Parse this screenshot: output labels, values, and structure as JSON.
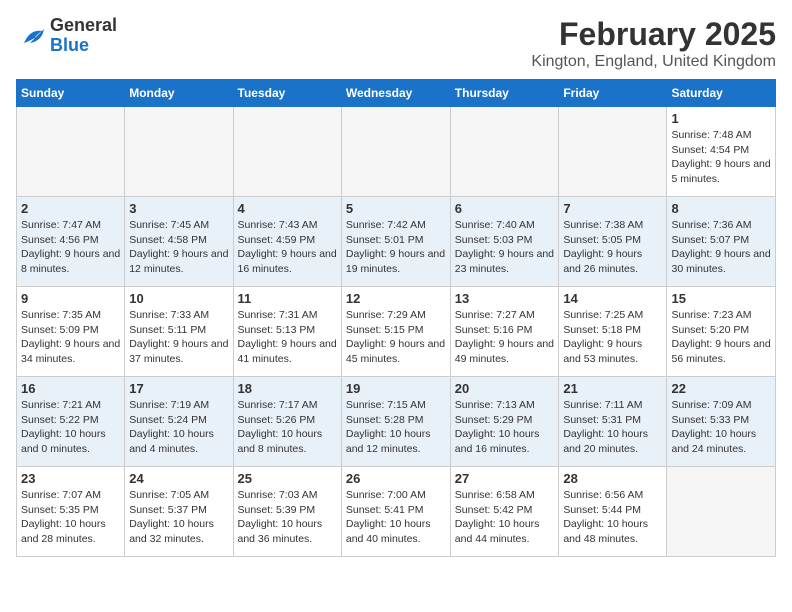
{
  "logo": {
    "text_general": "General",
    "text_blue": "Blue"
  },
  "title": "February 2025",
  "location": "Kington, England, United Kingdom",
  "weekdays": [
    "Sunday",
    "Monday",
    "Tuesday",
    "Wednesday",
    "Thursday",
    "Friday",
    "Saturday"
  ],
  "weeks": [
    [
      {
        "day": "",
        "info": ""
      },
      {
        "day": "",
        "info": ""
      },
      {
        "day": "",
        "info": ""
      },
      {
        "day": "",
        "info": ""
      },
      {
        "day": "",
        "info": ""
      },
      {
        "day": "",
        "info": ""
      },
      {
        "day": "1",
        "info": "Sunrise: 7:48 AM\nSunset: 4:54 PM\nDaylight: 9 hours and 5 minutes."
      }
    ],
    [
      {
        "day": "2",
        "info": "Sunrise: 7:47 AM\nSunset: 4:56 PM\nDaylight: 9 hours and 8 minutes."
      },
      {
        "day": "3",
        "info": "Sunrise: 7:45 AM\nSunset: 4:58 PM\nDaylight: 9 hours and 12 minutes."
      },
      {
        "day": "4",
        "info": "Sunrise: 7:43 AM\nSunset: 4:59 PM\nDaylight: 9 hours and 16 minutes."
      },
      {
        "day": "5",
        "info": "Sunrise: 7:42 AM\nSunset: 5:01 PM\nDaylight: 9 hours and 19 minutes."
      },
      {
        "day": "6",
        "info": "Sunrise: 7:40 AM\nSunset: 5:03 PM\nDaylight: 9 hours and 23 minutes."
      },
      {
        "day": "7",
        "info": "Sunrise: 7:38 AM\nSunset: 5:05 PM\nDaylight: 9 hours and 26 minutes."
      },
      {
        "day": "8",
        "info": "Sunrise: 7:36 AM\nSunset: 5:07 PM\nDaylight: 9 hours and 30 minutes."
      }
    ],
    [
      {
        "day": "9",
        "info": "Sunrise: 7:35 AM\nSunset: 5:09 PM\nDaylight: 9 hours and 34 minutes."
      },
      {
        "day": "10",
        "info": "Sunrise: 7:33 AM\nSunset: 5:11 PM\nDaylight: 9 hours and 37 minutes."
      },
      {
        "day": "11",
        "info": "Sunrise: 7:31 AM\nSunset: 5:13 PM\nDaylight: 9 hours and 41 minutes."
      },
      {
        "day": "12",
        "info": "Sunrise: 7:29 AM\nSunset: 5:15 PM\nDaylight: 9 hours and 45 minutes."
      },
      {
        "day": "13",
        "info": "Sunrise: 7:27 AM\nSunset: 5:16 PM\nDaylight: 9 hours and 49 minutes."
      },
      {
        "day": "14",
        "info": "Sunrise: 7:25 AM\nSunset: 5:18 PM\nDaylight: 9 hours and 53 minutes."
      },
      {
        "day": "15",
        "info": "Sunrise: 7:23 AM\nSunset: 5:20 PM\nDaylight: 9 hours and 56 minutes."
      }
    ],
    [
      {
        "day": "16",
        "info": "Sunrise: 7:21 AM\nSunset: 5:22 PM\nDaylight: 10 hours and 0 minutes."
      },
      {
        "day": "17",
        "info": "Sunrise: 7:19 AM\nSunset: 5:24 PM\nDaylight: 10 hours and 4 minutes."
      },
      {
        "day": "18",
        "info": "Sunrise: 7:17 AM\nSunset: 5:26 PM\nDaylight: 10 hours and 8 minutes."
      },
      {
        "day": "19",
        "info": "Sunrise: 7:15 AM\nSunset: 5:28 PM\nDaylight: 10 hours and 12 minutes."
      },
      {
        "day": "20",
        "info": "Sunrise: 7:13 AM\nSunset: 5:29 PM\nDaylight: 10 hours and 16 minutes."
      },
      {
        "day": "21",
        "info": "Sunrise: 7:11 AM\nSunset: 5:31 PM\nDaylight: 10 hours and 20 minutes."
      },
      {
        "day": "22",
        "info": "Sunrise: 7:09 AM\nSunset: 5:33 PM\nDaylight: 10 hours and 24 minutes."
      }
    ],
    [
      {
        "day": "23",
        "info": "Sunrise: 7:07 AM\nSunset: 5:35 PM\nDaylight: 10 hours and 28 minutes."
      },
      {
        "day": "24",
        "info": "Sunrise: 7:05 AM\nSunset: 5:37 PM\nDaylight: 10 hours and 32 minutes."
      },
      {
        "day": "25",
        "info": "Sunrise: 7:03 AM\nSunset: 5:39 PM\nDaylight: 10 hours and 36 minutes."
      },
      {
        "day": "26",
        "info": "Sunrise: 7:00 AM\nSunset: 5:41 PM\nDaylight: 10 hours and 40 minutes."
      },
      {
        "day": "27",
        "info": "Sunrise: 6:58 AM\nSunset: 5:42 PM\nDaylight: 10 hours and 44 minutes."
      },
      {
        "day": "28",
        "info": "Sunrise: 6:56 AM\nSunset: 5:44 PM\nDaylight: 10 hours and 48 minutes."
      },
      {
        "day": "",
        "info": ""
      }
    ]
  ]
}
